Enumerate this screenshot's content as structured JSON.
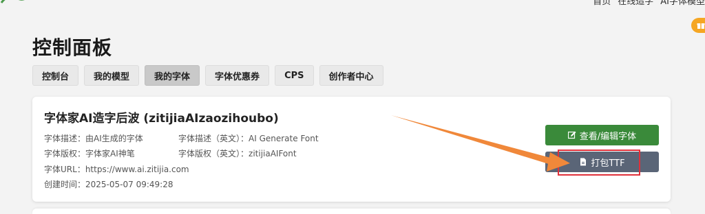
{
  "header": {
    "nav_items": [
      "首页",
      "在线造字",
      "AI字体模型"
    ]
  },
  "page": {
    "title": "控制面板"
  },
  "tabs": [
    {
      "label": "控制台"
    },
    {
      "label": "我的模型"
    },
    {
      "label": "我的字体"
    },
    {
      "label": "字体优惠券"
    },
    {
      "label": "CPS"
    },
    {
      "label": "创作者中心"
    }
  ],
  "active_tab": "我的字体",
  "font_card": {
    "name": "字体家AI造字后波 (zitijiaAIzaozihoubo)",
    "desc_label": "字体描述：",
    "desc_value": "由AI生成的字体",
    "desc_en_label": "字体描述（英文）：",
    "desc_en_value": "AI Generate Font",
    "copyright_label": "字体版权：",
    "copyright_value": "字体家AI神笔",
    "copyright_en_label": "字体版权（英文）：",
    "copyright_en_value": "zitijiaAIFont",
    "url_label": "字体URL：",
    "url_value": "https://www.ai.zitijia.com",
    "created_label": "创建时间：",
    "created_value": "2025-05-07 09:49:28",
    "edit_button": "查看/编辑字体",
    "pack_button": "打包TTF"
  },
  "colors": {
    "edit_button": "#3a8a3a",
    "pack_button": "#5a6577",
    "annotation_arrow": "#f0883a",
    "annotation_box": "#e0303a",
    "gift_badge": "#f5a623"
  },
  "icons": {
    "edit": "edit-icon",
    "pack": "file-icon",
    "gift": "gift-icon"
  }
}
